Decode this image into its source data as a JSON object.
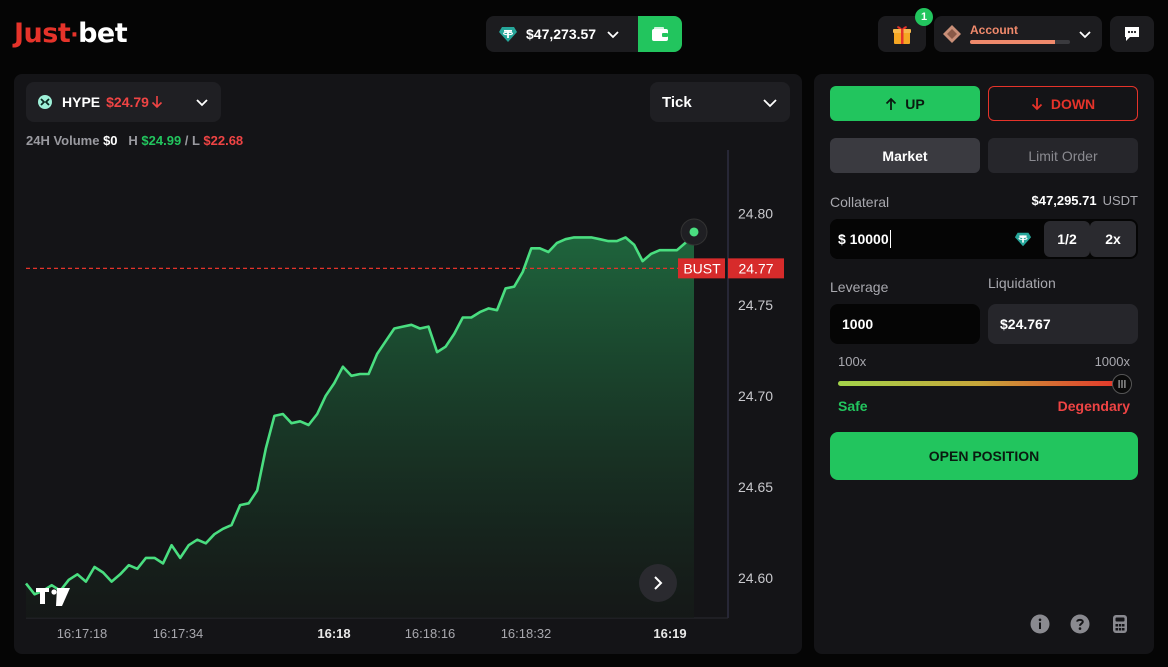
{
  "header": {
    "logo_left": "Just",
    "logo_right": "bet",
    "balance": "$47,273.57",
    "gift_count": "1",
    "account_label": "Account",
    "account_progress": 0.85
  },
  "chart_panel": {
    "asset_symbol": "HYPE",
    "asset_price": "$24.79",
    "interval": "Tick",
    "stats_volume_label": "24H Volume",
    "stats_volume": "$0",
    "stats_high_label": "H",
    "stats_high": "$24.99",
    "stats_sep": "/",
    "stats_low_label": "L",
    "stats_low": "$22.68",
    "bust_label": "BUST",
    "bust_value": "24.77",
    "logo_mark": "TV"
  },
  "chart_data": {
    "type": "area",
    "x_tick_labels": [
      "16:17:18",
      "16:17:34",
      "16:18",
      "16:18:16",
      "16:18:32",
      "16:19"
    ],
    "y_tick_labels": [
      "24.80",
      "24.75",
      "24.70",
      "24.65",
      "24.60"
    ],
    "ylim": [
      24.578,
      24.835
    ],
    "bust_level": 24.77,
    "series": [
      {
        "values": [
          24.597,
          24.591,
          24.593,
          24.596,
          24.593,
          24.599,
          24.602,
          24.598,
          24.606,
          24.603,
          24.598,
          24.602,
          24.607,
          24.605,
          24.611,
          24.611,
          24.608,
          24.618,
          24.611,
          24.618,
          24.621,
          24.619,
          24.624,
          24.627,
          24.629,
          24.64,
          24.641,
          24.648,
          24.671,
          24.689,
          24.69,
          24.685,
          24.686,
          24.684,
          24.69,
          24.7,
          24.707,
          24.716,
          24.711,
          24.712,
          24.712,
          24.723,
          24.73,
          24.737,
          24.738,
          24.739,
          24.737,
          24.738,
          24.724,
          24.727,
          24.734,
          24.743,
          24.743,
          24.746,
          24.748,
          24.747,
          24.759,
          24.76,
          24.768,
          24.781,
          24.781,
          24.779,
          24.784,
          24.786,
          24.787,
          24.787,
          24.787,
          24.786,
          24.785,
          24.785,
          24.787,
          24.783,
          24.774,
          24.778,
          24.78,
          24.78,
          24.78,
          24.784,
          24.79
        ]
      }
    ]
  },
  "trade_panel": {
    "up_label": "UP",
    "down_label": "DOWN",
    "tab_market": "Market",
    "tab_limit": "Limit Order",
    "collateral_label": "Collateral",
    "collateral_amount": "$47,295.71",
    "collateral_currency": "USDT",
    "collateral_input": "$ 10000",
    "half_label": "1/2",
    "double_label": "2x",
    "leverage_label": "Leverage",
    "liquidation_label": "Liquidation",
    "leverage_value": "1000",
    "liquidation_value": "$24.767",
    "range_min": "100x",
    "range_max": "1000x",
    "leverage_level": 1.0,
    "safe_label": "Safe",
    "degen_label": "Degendary",
    "open_label": "OPEN POSITION"
  }
}
